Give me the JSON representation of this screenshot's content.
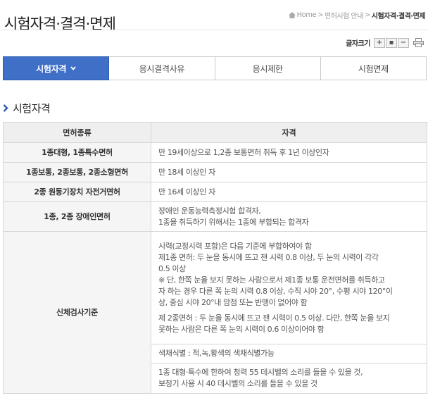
{
  "page": {
    "title": "시험자격·결격·면제"
  },
  "breadcrumb": {
    "home": "Home",
    "parent": "면허시험 안내",
    "current": "시험자격·결격·면제",
    "separator": ">"
  },
  "font_size": {
    "label": "글자크기",
    "increase": "+",
    "reset": "▪",
    "decrease": "−"
  },
  "tabs": [
    {
      "label": "시험자격",
      "active": true
    },
    {
      "label": "응시결격사유",
      "active": false
    },
    {
      "label": "응시제한",
      "active": false
    },
    {
      "label": "시험면제",
      "active": false
    }
  ],
  "section": {
    "title": "시험자격"
  },
  "table": {
    "headers": [
      "면허종류",
      "자격"
    ],
    "rows": [
      {
        "kind": "1종대형, 1종특수면허",
        "lines": [
          "만 19세이상으로 1,2종 보통면허 취득 후 1년 이상인자"
        ]
      },
      {
        "kind": "1종보통, 2종보통, 2종소형면허",
        "lines": [
          "만 18세 이상인 자"
        ]
      },
      {
        "kind": "2종 원동기장치 자전거면허",
        "lines": [
          "만 16세 이상인 자"
        ]
      },
      {
        "kind": "1종, 2종 장애인면허",
        "lines": [
          "장애인 운동능력측정시험 합격자,",
          "1종을 취득하기 위해서는 1종에 부합되는 합격자"
        ]
      }
    ],
    "physical": {
      "kind": "신체검사기준",
      "vision": [
        "시력(교정시력 포함)은 다음 기준에 부합하여야 함",
        "제1종 면허: 두 눈을 동시에 뜨고 잰 시력 0.8 이상, 두 눈의 시력이 각각",
        "0.5 이상",
        "※ 단, 한쪽 눈을 보지 못하는 사람으로서 제1종 보통 운전면허를 취득하고",
        "자 하는 경우 다른 쪽 눈의 시력 0.8 이상, 수직 시야 20°, 수평 시야 120°이",
        "상, 중심 시야 20°내 암점 또는 반맹이 없어야 함"
      ],
      "vision2": [
        "제 2종면허 : 두 눈을 동시에 뜨고 잰 시력이 0.5 이상. 다만, 한쪽 눈을 보지",
        "못하는 사람은 다른 쪽 눈의 시력이 0.6 이상이어야 함"
      ],
      "color": "색채식별 : 적,녹,황색의 색채식별가능",
      "hearing": [
        "1종 대형·특수에 한하여 청력 55 데시벨의 소리를 들을 수 있을 것,",
        "보청기 사용 시 40 데시벨의 소리를 들을 수 있을 것"
      ]
    }
  },
  "colors": {
    "tab_active": "#3f6fc6",
    "header_bg": "#efefef",
    "bullet": "#2b5cb2"
  },
  "icons": {
    "home": "home-icon",
    "tab_chevron": "chevron-down-icon",
    "section": "chevron-right-icon",
    "print": "print-icon"
  }
}
